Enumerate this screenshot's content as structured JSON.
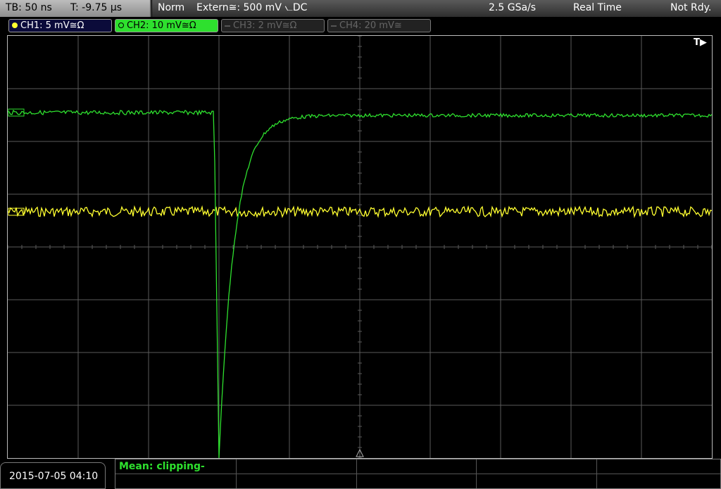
{
  "header": {
    "timebase": "TB: 50 ns",
    "trigger_time": "T: -9.75 µs",
    "mode": "Norm",
    "trigger_source": "Extern≅: 500 mV ⦦DC",
    "sample_rate": "2.5 GSa/s",
    "acq_mode": "Real Time",
    "status": "Not Rdy."
  },
  "channels": [
    {
      "label": "CH1: 5 mV≅Ω",
      "color": "#ffff30",
      "active": true
    },
    {
      "label": "CH2: 10 mV≅Ω",
      "color": "#2ee02e",
      "active": true
    },
    {
      "label": "CH3: 2 mV≅Ω",
      "color": "#666666",
      "active": false
    },
    {
      "label": "CH4: 20 mV≅",
      "color": "#666666",
      "active": false
    }
  ],
  "trigger_marker": "T▶",
  "measurement": {
    "label": "Mean: clipping-"
  },
  "datetime": "2015-07-05 04:10",
  "colors": {
    "ch1": "#ffff30",
    "ch2": "#2ee02e",
    "grid": "#5a5a5a"
  }
}
